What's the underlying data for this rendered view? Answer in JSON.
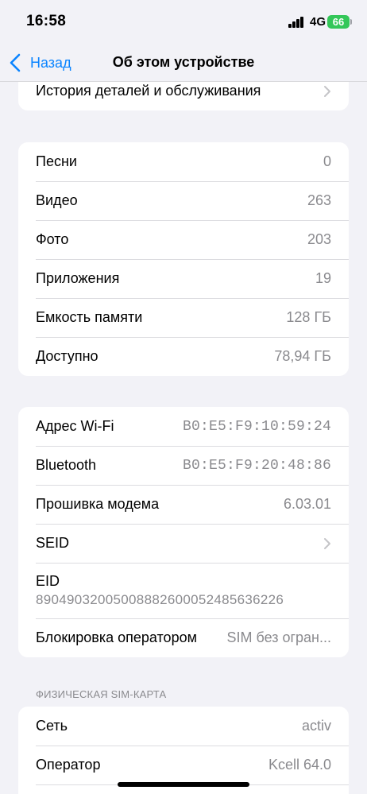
{
  "status": {
    "time": "16:58",
    "network": "4G",
    "battery": "66"
  },
  "nav": {
    "back_label": "Назад",
    "title": "Об этом устройстве"
  },
  "group0": {
    "history_label": "История деталей и обслуживания"
  },
  "media": {
    "rows": [
      {
        "label": "Песни",
        "value": "0"
      },
      {
        "label": "Видео",
        "value": "263"
      },
      {
        "label": "Фото",
        "value": "203"
      },
      {
        "label": "Приложения",
        "value": "19"
      },
      {
        "label": "Емкость памяти",
        "value": "128 ГБ"
      },
      {
        "label": "Доступно",
        "value": "78,94 ГБ"
      }
    ]
  },
  "network": {
    "wifi_label": "Адрес Wi-Fi",
    "wifi_value": "B0:E5:F9:10:59:24",
    "bt_label": "Bluetooth",
    "bt_value": "B0:E5:F9:20:48:86",
    "modem_label": "Прошивка модема",
    "modem_value": "6.03.01",
    "seid_label": "SEID",
    "eid_label": "EID",
    "eid_value": "89049032005008882600052485636226",
    "lock_label": "Блокировка оператором",
    "lock_value": "SIM без огран..."
  },
  "sim": {
    "header": "ФИЗИЧЕСКАЯ SIM-КАРТА",
    "network_label": "Сеть",
    "network_value": "activ",
    "carrier_label": "Оператор",
    "carrier_value": "Kcell 64.0"
  }
}
